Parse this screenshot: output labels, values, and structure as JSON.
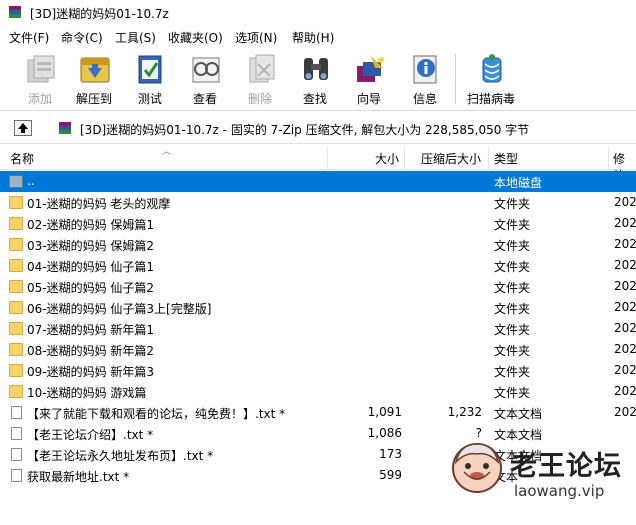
{
  "window": {
    "title": "[3D]迷糊的妈妈01-10.7z"
  },
  "menu": [
    "文件(F)",
    "命令(C)",
    "工具(S)",
    "收藏夹(O)",
    "选项(N)",
    "帮助(H)"
  ],
  "toolbar": [
    {
      "label": "添加",
      "icon": "add-icon",
      "enabled": false
    },
    {
      "label": "解压到",
      "icon": "extract-icon",
      "enabled": true
    },
    {
      "label": "测试",
      "icon": "test-icon",
      "enabled": true
    },
    {
      "label": "查看",
      "icon": "view-icon",
      "enabled": true
    },
    {
      "label": "删除",
      "icon": "delete-icon",
      "enabled": false
    },
    {
      "label": "查找",
      "icon": "find-icon",
      "enabled": true
    },
    {
      "label": "向导",
      "icon": "wizard-icon",
      "enabled": true
    },
    {
      "label": "信息",
      "icon": "info-icon",
      "enabled": true
    },
    {
      "label": "扫描病毒",
      "icon": "virus-scan-icon",
      "enabled": true
    }
  ],
  "path": "[3D]迷糊的妈妈01-10.7z - 固实的 7-Zip 压缩文件, 解包大小为 228,585,050 字节",
  "columns": {
    "name": "名称",
    "size": "大小",
    "packed": "压缩后大小",
    "type": "类型",
    "modified": "修改"
  },
  "rows": [
    {
      "name": "..",
      "size": "",
      "packed": "",
      "type": "本地磁盘",
      "modified": "",
      "kind": "up",
      "selected": true
    },
    {
      "name": "01-迷糊的妈妈 老头的观摩",
      "size": "",
      "packed": "",
      "type": "文件夹",
      "modified": "202",
      "kind": "folder"
    },
    {
      "name": "02-迷糊的妈妈 保姆篇1",
      "size": "",
      "packed": "",
      "type": "文件夹",
      "modified": "202",
      "kind": "folder"
    },
    {
      "name": "03-迷糊的妈妈 保姆篇2",
      "size": "",
      "packed": "",
      "type": "文件夹",
      "modified": "202",
      "kind": "folder"
    },
    {
      "name": "04-迷糊的妈妈 仙子篇1",
      "size": "",
      "packed": "",
      "type": "文件夹",
      "modified": "202",
      "kind": "folder"
    },
    {
      "name": "05-迷糊的妈妈 仙子篇2",
      "size": "",
      "packed": "",
      "type": "文件夹",
      "modified": "202",
      "kind": "folder"
    },
    {
      "name": "06-迷糊的妈妈 仙子篇3上[完整版]",
      "size": "",
      "packed": "",
      "type": "文件夹",
      "modified": "202",
      "kind": "folder"
    },
    {
      "name": "07-迷糊的妈妈 新年篇1",
      "size": "",
      "packed": "",
      "type": "文件夹",
      "modified": "202",
      "kind": "folder"
    },
    {
      "name": "08-迷糊的妈妈 新年篇2",
      "size": "",
      "packed": "",
      "type": "文件夹",
      "modified": "202",
      "kind": "folder"
    },
    {
      "name": "09-迷糊的妈妈 新年篇3",
      "size": "",
      "packed": "",
      "type": "文件夹",
      "modified": "202",
      "kind": "folder"
    },
    {
      "name": "10-迷糊的妈妈 游戏篇",
      "size": "",
      "packed": "",
      "type": "文件夹",
      "modified": "202",
      "kind": "folder"
    },
    {
      "name": "【来了就能下载和观看的论坛，纯免费！】.txt *",
      "size": "1,091",
      "packed": "1,232",
      "type": "文本文档",
      "modified": "202",
      "kind": "file"
    },
    {
      "name": "【老王论坛介绍】.txt *",
      "size": "1,086",
      "packed": "?",
      "type": "文本文档",
      "modified": "",
      "kind": "file"
    },
    {
      "name": "【老王论坛永久地址发布页】.txt *",
      "size": "173",
      "packed": "?",
      "type": "文本文档",
      "modified": "",
      "kind": "file"
    },
    {
      "name": "获取最新地址.txt *",
      "size": "599",
      "packed": "?",
      "type": "文本",
      "modified": "",
      "kind": "file"
    }
  ],
  "watermark": {
    "name": "老王论坛",
    "url": "laowang.vip"
  },
  "colors": {
    "selection": "#0078d7",
    "folder": "#f7d36a"
  }
}
